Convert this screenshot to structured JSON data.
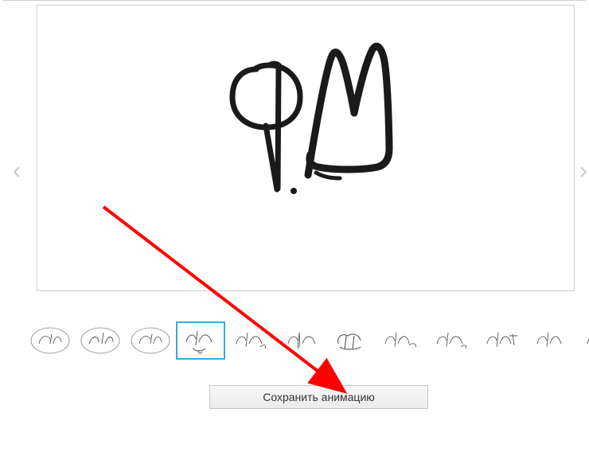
{
  "signature_text": "Р.М",
  "thumbnails": {
    "selected_index": 3,
    "count": 12
  },
  "button": {
    "save_label": "Сохранить анимацию"
  },
  "nav": {
    "prev": "‹",
    "next": "›"
  },
  "annotation": {
    "arrow_color": "#ff0000"
  }
}
